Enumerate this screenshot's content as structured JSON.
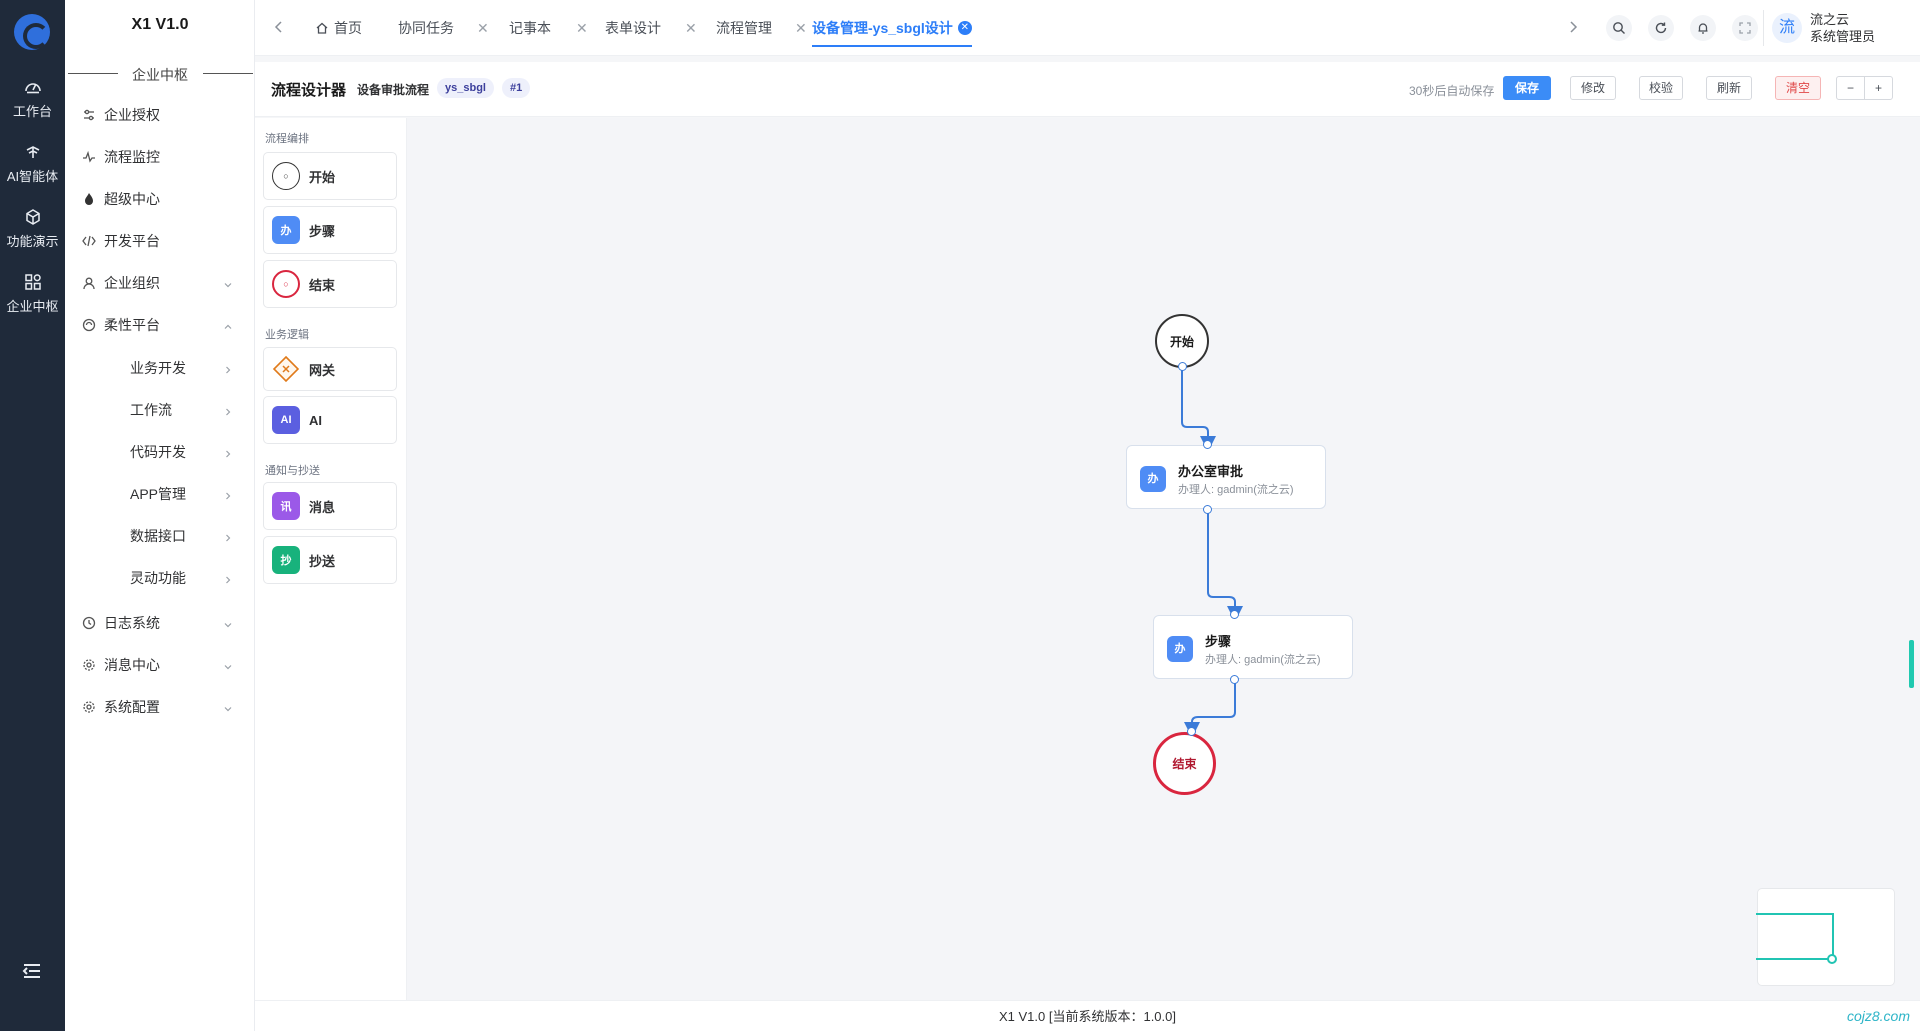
{
  "rail": {
    "items": [
      {
        "label": "工作台",
        "icon": "dashboard-icon"
      },
      {
        "label": "AI智能体",
        "icon": "ai-agent-icon"
      },
      {
        "label": "功能演示",
        "icon": "cube-icon"
      },
      {
        "label": "企业中枢",
        "icon": "apps-grid-icon"
      }
    ]
  },
  "sidebar": {
    "brand": "X1 V1.0",
    "section_title": "企业中枢",
    "items": [
      {
        "label": "企业授权",
        "icon": "sliders-icon"
      },
      {
        "label": "流程监控",
        "icon": "pulse-icon"
      },
      {
        "label": "超级中心",
        "icon": "flame-icon"
      },
      {
        "label": "开发平台",
        "icon": "code-icon"
      },
      {
        "label": "企业组织",
        "icon": "user-icon",
        "arrow": "down"
      },
      {
        "label": "柔性平台",
        "icon": "flex-icon",
        "arrow": "up"
      }
    ],
    "sub_items": [
      {
        "label": "业务开发"
      },
      {
        "label": "工作流"
      },
      {
        "label": "代码开发"
      },
      {
        "label": "APP管理"
      },
      {
        "label": "数据接口"
      },
      {
        "label": "灵动功能"
      }
    ],
    "bottom_items": [
      {
        "label": "日志系统",
        "icon": "clock-icon"
      },
      {
        "label": "消息中心",
        "icon": "gear-icon"
      },
      {
        "label": "系统配置",
        "icon": "gear-icon"
      }
    ]
  },
  "tabs": [
    {
      "label": "首页",
      "closable": false
    },
    {
      "label": "协同任务",
      "closable": true
    },
    {
      "label": "记事本",
      "closable": true
    },
    {
      "label": "表单设计",
      "closable": true
    },
    {
      "label": "流程管理",
      "closable": true
    },
    {
      "label": "设备管理-ys_sbgl设计",
      "closable": true,
      "active": true
    }
  ],
  "user": {
    "avatar": "流",
    "name": "流之云",
    "role": "系统管理员"
  },
  "toolbar": {
    "title": "流程设计器",
    "flow_name": "设备审批流程",
    "code_tag": "ys_sbgl",
    "version_tag": "#1",
    "autosave": "30秒后自动保存",
    "save": "保存",
    "modify": "修改",
    "validate": "校验",
    "refresh": "刷新",
    "clear": "清空",
    "zoom_out": "−",
    "zoom_in": "+"
  },
  "palette": {
    "sections": [
      {
        "title": "流程编排",
        "items": [
          {
            "label": "开始",
            "icon": "start-circle-icon"
          },
          {
            "label": "步骤",
            "icon": "step-icon",
            "glyph": "办"
          },
          {
            "label": "结束",
            "icon": "end-circle-icon"
          }
        ]
      },
      {
        "title": "业务逻辑",
        "items": [
          {
            "label": "网关",
            "icon": "gateway-diamond-icon"
          },
          {
            "label": "AI",
            "icon": "ai-icon",
            "glyph": "AI"
          }
        ]
      },
      {
        "title": "通知与抄送",
        "items": [
          {
            "label": "消息",
            "icon": "message-icon",
            "glyph": "讯"
          },
          {
            "label": "抄送",
            "icon": "cc-icon",
            "glyph": "抄"
          }
        ]
      }
    ]
  },
  "diagram": {
    "start": "开始",
    "end": "结束",
    "nodes": [
      {
        "glyph": "办",
        "title": "办公室审批",
        "assignee": "办理人: gadmin(流之云)"
      },
      {
        "glyph": "办",
        "title": "步骤",
        "assignee": "办理人: gadmin(流之云)"
      }
    ]
  },
  "footer": {
    "version": "X1 V1.0 [当前系统版本：1.0.0]",
    "watermark": "cojz8.com"
  },
  "colors": {
    "accent": "#2d7ef8",
    "rail": "#1f2a3a",
    "end": "#d9263f",
    "edge": "#3b7bd8"
  }
}
